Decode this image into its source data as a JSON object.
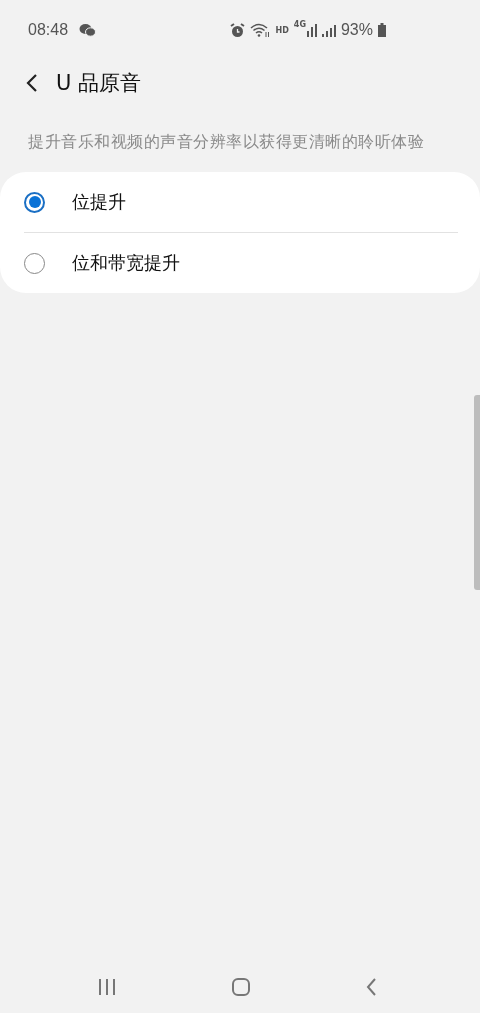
{
  "status_bar": {
    "time": "08:48",
    "network_label": "HD",
    "network_type": "4G",
    "battery": "93%"
  },
  "header": {
    "title": "U 品原音"
  },
  "description": "提升音乐和视频的声音分辨率以获得更清晰的聆听体验",
  "options": [
    {
      "label": "位提升",
      "selected": true
    },
    {
      "label": "位和带宽提升",
      "selected": false
    }
  ]
}
